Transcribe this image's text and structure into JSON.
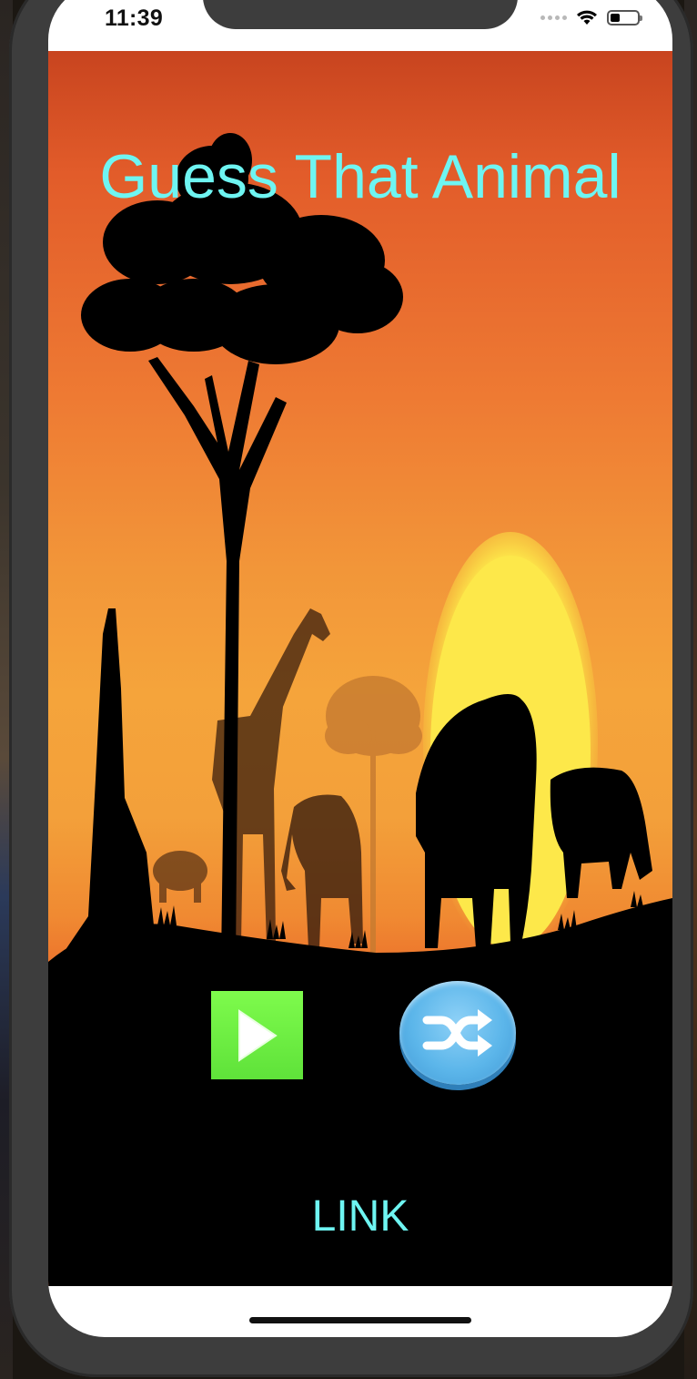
{
  "status_bar": {
    "time": "11:39",
    "battery_level": 0.35,
    "icons": [
      "cellular-dots-icon",
      "wifi-icon",
      "battery-icon"
    ]
  },
  "app": {
    "title": "Guess That Animal",
    "play_icon": "play-icon",
    "shuffle_icon": "shuffle-icon",
    "link_label": "LINK"
  },
  "colors": {
    "title": "#6ef5f2",
    "sky_top": "#c8441f",
    "sky_mid": "#f5a43b",
    "sun": "#fde84a",
    "silhouette": "#000000",
    "play_button": "#6eef43",
    "shuffle_button": "#5cb6ea"
  }
}
